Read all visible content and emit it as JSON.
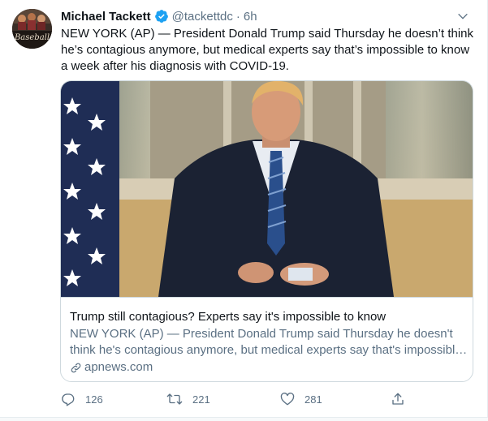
{
  "tweet": {
    "author_name": "Michael Tackett",
    "handle": "@tackettdc",
    "separator": "·",
    "time": "6h",
    "verified": true,
    "text": "NEW YORK (AP) — President Donald Trump said Thursday he doesn’t think he’s contagious anymore, but medical experts say that’s impossible to know a week after his diagnosis with COVID-19."
  },
  "avatar": {
    "label": "Baseball",
    "icon": "avatar-image"
  },
  "card": {
    "image_icon": "news-photo",
    "title": "Trump still contagious? Experts say it's impossible to know",
    "description_line1": "NEW YORK (AP) — President Donald Trump said Thursday he doesn't",
    "description_line2": "think he's contagious anymore, but medical experts say that's impossibl…",
    "domain": "apnews.com",
    "domain_icon": "link-icon"
  },
  "actions": {
    "reply_count": "126",
    "retweet_count": "221",
    "like_count": "281",
    "reply_icon": "reply-icon",
    "retweet_icon": "retweet-icon",
    "like_icon": "heart-icon",
    "share_icon": "share-icon"
  },
  "colors": {
    "accent": "#1da1f2",
    "secondary_text": "#5b7083",
    "border": "#cfd9de"
  }
}
